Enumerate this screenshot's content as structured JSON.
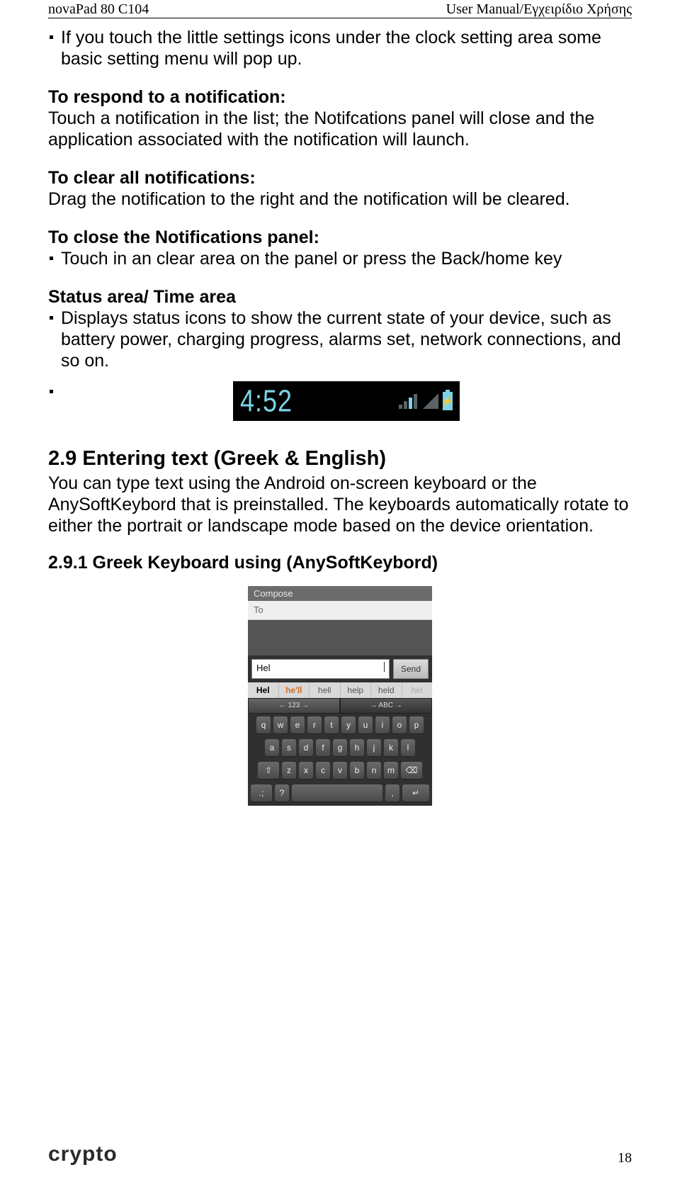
{
  "header": {
    "left": "novaPad 80 C104",
    "right": "User Manual/Εγχειρίδιο Χρήσης"
  },
  "bullet1": "If you touch the little settings icons under the clock setting area some basic setting menu will pop up.",
  "respond": {
    "title": "To respond to a notification:",
    "body": "Touch a notification in the list; the Notifcations panel will close and the application associated with the notification will launch."
  },
  "clear": {
    "title": "To clear all notifications:",
    "body": "Drag the notification to the right and the notification will be cleared."
  },
  "close": {
    "title": "To close the Notifications panel:",
    "bullet": "Touch in an clear area on the panel or press the Back/home key"
  },
  "status": {
    "title": "Status area/ Time area",
    "bullet": "Displays status icons to show the current state of your device, such as battery power, charging progress, alarms set, network connections, and so on."
  },
  "statusbar": {
    "time": "4:52"
  },
  "sec29": {
    "title": "2.9 Entering text (Greek & English)",
    "body": "You can type text using the Android on-screen keyboard or the AnySoftKeybord that is preinstalled. The keyboards automatically rotate to either the portrait or landscape mode based on the device orientation."
  },
  "sec291": "2.9.1 Greek Keyboard using (AnySoftKeybord)",
  "phone": {
    "compose": "Compose",
    "to": "To",
    "input": "Hel",
    "send": "Send",
    "suggest": [
      "Hel",
      "he'll",
      "hell",
      "help",
      "held",
      "hel"
    ],
    "tabs": [
      "←  123  →",
      "→  ABC  →"
    ],
    "row1": [
      "q",
      "w",
      "e",
      "r",
      "t",
      "y",
      "u",
      "i",
      "o",
      "p"
    ],
    "row2": [
      "a",
      "s",
      "d",
      "f",
      "g",
      "h",
      "j",
      "k",
      "l"
    ],
    "row3": [
      "⇧",
      "z",
      "x",
      "c",
      "v",
      "b",
      "n",
      "m",
      "⌫"
    ],
    "row4": [
      ".;",
      "?",
      ",",
      "↵"
    ]
  },
  "footer": {
    "logo": "crypto",
    "page": "18"
  }
}
